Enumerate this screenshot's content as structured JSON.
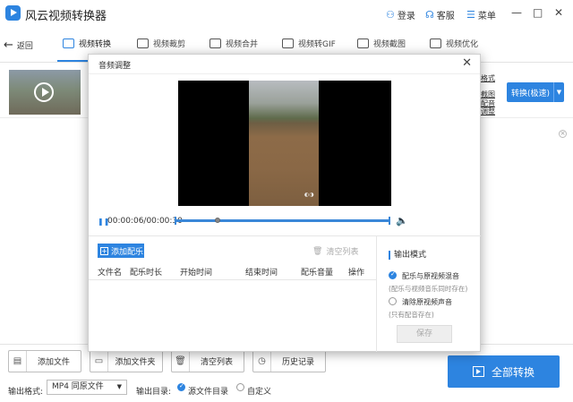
{
  "app": {
    "title": "风云视频转换器",
    "login": "登录",
    "service": "客服",
    "menu": "菜单",
    "minimize": "—",
    "maximize": "□",
    "close": "✕"
  },
  "tabs": {
    "back": "返回",
    "items": [
      {
        "label": "视频转换"
      },
      {
        "label": "视频裁剪"
      },
      {
        "label": "视频合并"
      },
      {
        "label": "视频转GIF"
      },
      {
        "label": "视频截图"
      },
      {
        "label": "视频优化"
      }
    ]
  },
  "file_row": {
    "links": [
      "格式",
      "截图",
      "配音",
      "调整"
    ],
    "convert_label": "转换(极速)"
  },
  "bottom": {
    "add_file": "添加文件",
    "add_folder": "添加文件夹",
    "clear_list": "清空列表",
    "history": "历史记录",
    "convert_all": "全部转换",
    "output_format_label": "输出格式:",
    "output_format_value": "MP4 同原文件",
    "output_dir_label": "输出目录:",
    "dir_source": "源文件目录",
    "dir_custom": "自定义"
  },
  "dialog": {
    "title": "音频调整",
    "close": "✕",
    "time": "00:00:06/00:00:30",
    "play_progress": 0.2,
    "add_music": "添加配乐",
    "clear_list": "清空列表",
    "columns": [
      "文件名",
      "配乐时长",
      "开始时间",
      "结束时间",
      "配乐音量",
      "操作"
    ],
    "output_mode_title": "输出模式",
    "mode_mix": "配乐与原视频混音",
    "mode_mix_note": "(配乐与视频音乐同时存在)",
    "mode_clear": "清除原视频声音",
    "mode_clear_note": "(只有配音存在)",
    "save": "保存"
  },
  "colors": {
    "accent": "#2d84e0"
  }
}
